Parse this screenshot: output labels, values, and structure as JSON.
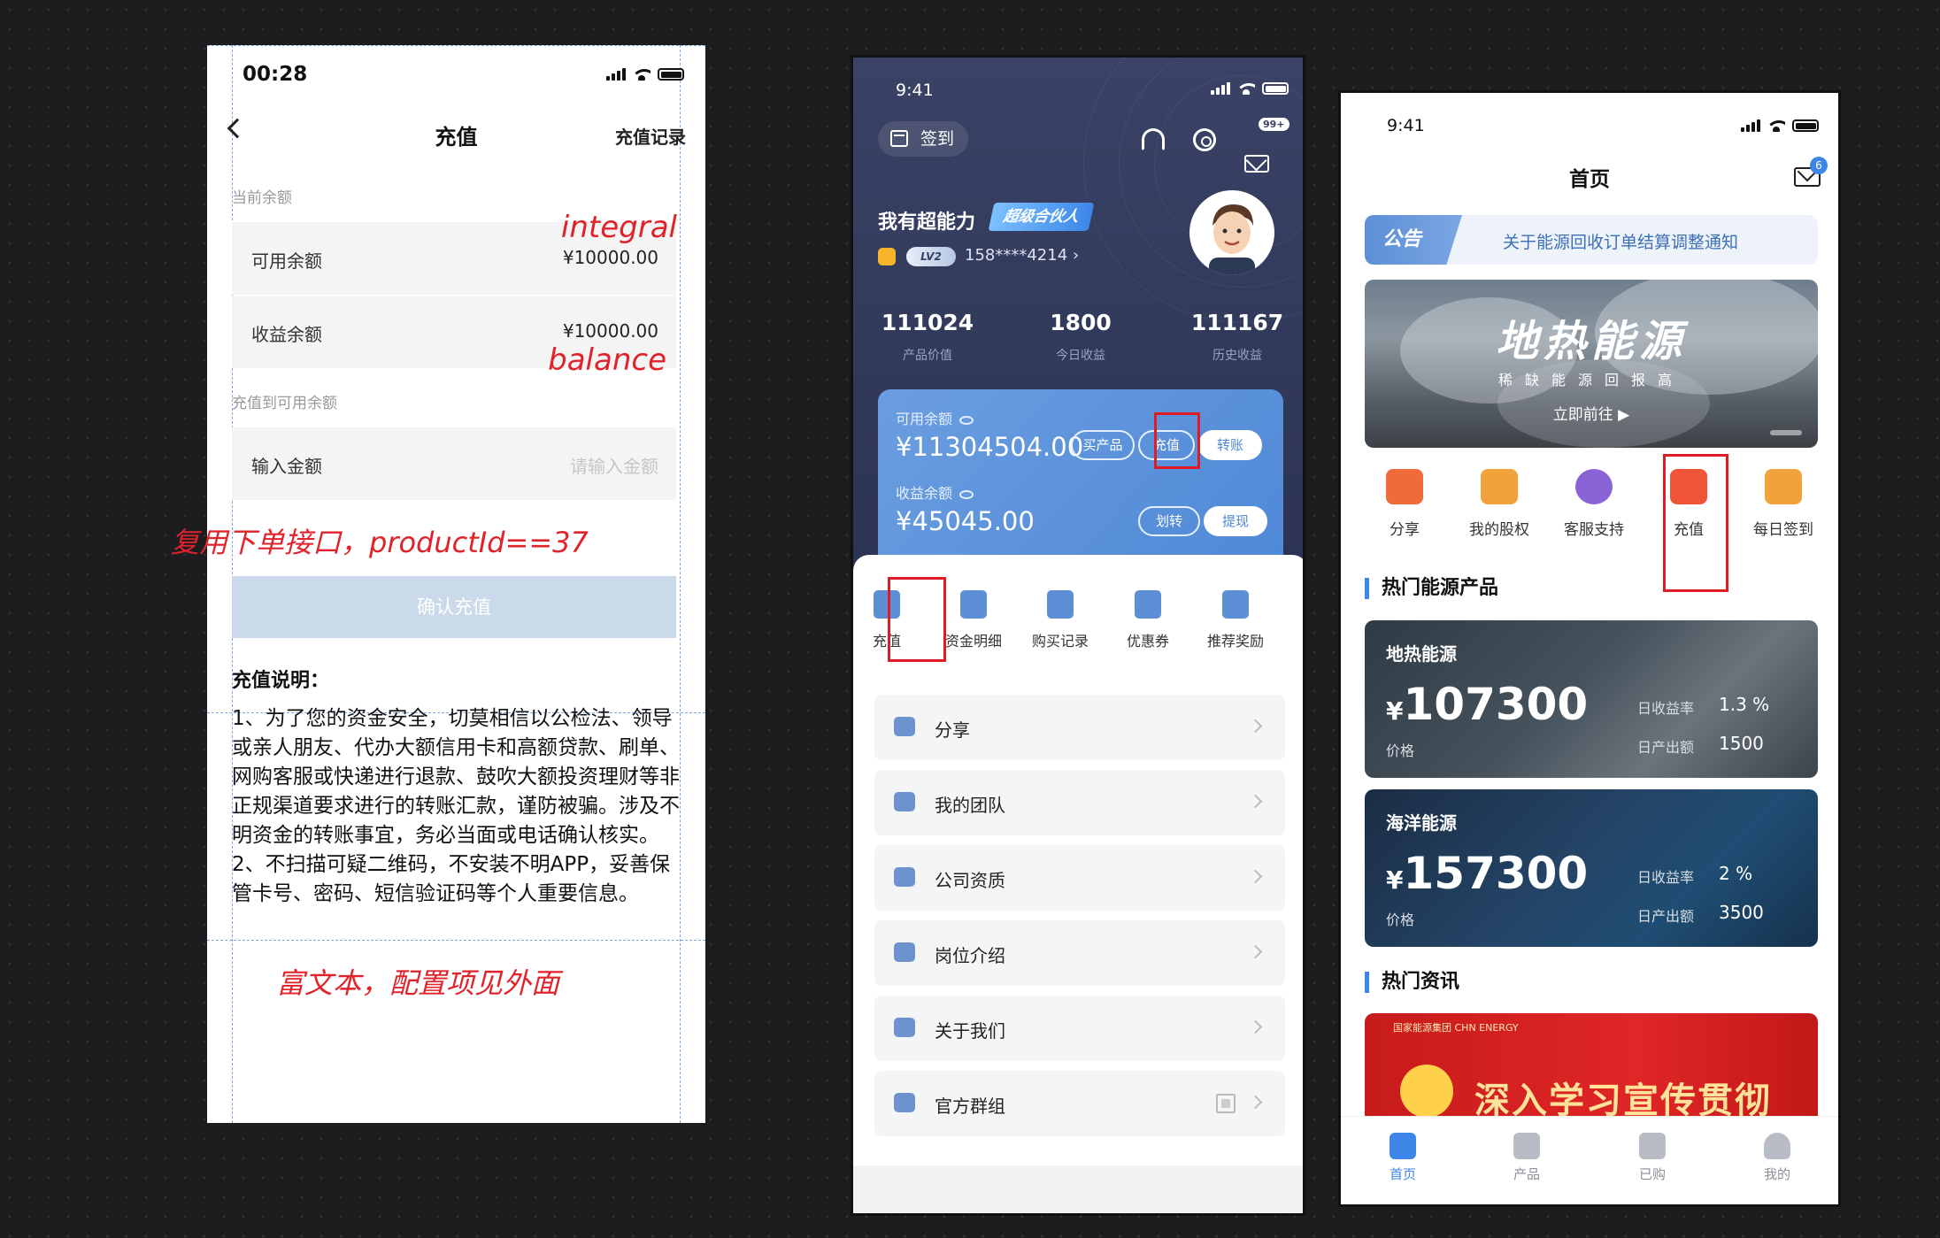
{
  "screen1": {
    "status_time": "00:28",
    "title": "充值",
    "record_link": "充值记录",
    "section_current": "当前余额",
    "available_label": "可用余额",
    "available_value": "¥10000.00",
    "earnings_label": "收益余额",
    "earnings_value": "¥10000.00",
    "section_recharge": "充值到可用余额",
    "amount_label": "输入金额",
    "amount_placeholder": "请输入金额",
    "confirm_button": "确认充值",
    "desc_title": "充值说明：",
    "desc_text": "1、为了您的资金安全，切莫相信以公检法、领导或亲人朋友、代办大额信用卡和高额贷款、刷单、网购客服或快递进行退款、鼓吹大额投资理财等非正规渠道要求进行的转账汇款，谨防被骗。涉及不明资金的转账事宜，务必当面或电话确认核实。2、不扫描可疑二维码，不安装不明APP，妥善保管卡号、密码、短信验证码等个人重要信息。",
    "annotations": {
      "integral": "integral",
      "balance": "balance",
      "reuse": "复用下单接口，productId==37",
      "rich_text": "富文本，配置项见外面"
    }
  },
  "screen2": {
    "status_time": "9:41",
    "checkin_label": "签到",
    "mail_badge": "99+",
    "user_name": "我有超能力",
    "partner_tag": "超级合伙人",
    "level_tag": "LV2",
    "phone": "158****4214 ›",
    "stats": [
      {
        "value": "111024",
        "label": "产品价值"
      },
      {
        "value": "1800",
        "label": "今日收益"
      },
      {
        "value": "111167",
        "label": "历史收益"
      }
    ],
    "available_label": "可用余额",
    "available_value": "¥11304504.00",
    "earnings_label": "收益余额",
    "earnings_value": "¥45045.00",
    "btn_buy": "买产品",
    "btn_recharge": "充值",
    "btn_transfer": "转账",
    "btn_move": "划转",
    "btn_withdraw": "提现",
    "quick_items": [
      "充值",
      "资金明细",
      "购买记录",
      "优惠券",
      "推荐奖励"
    ],
    "menu_items": [
      "分享",
      "我的团队",
      "公司资质",
      "岗位介绍",
      "关于我们",
      "官方群组"
    ]
  },
  "screen3": {
    "status_time": "9:41",
    "title": "首页",
    "mail_badge": "6",
    "notice_tag": "公告",
    "notice_text": "关于能源回收订单结算调整通知",
    "banner_title": "地热能源",
    "banner_sub": "稀缺能源回报高",
    "banner_cta": "立即前往 ▶",
    "nav_items": [
      {
        "label": "分享",
        "color": "#f06a3a"
      },
      {
        "label": "我的股权",
        "color": "#f2a23a"
      },
      {
        "label": "客服支持",
        "color": "#8a63d6"
      },
      {
        "label": "充值",
        "color": "#f0553a"
      },
      {
        "label": "每日签到",
        "color": "#f2a23a"
      }
    ],
    "hot_products_title": "热门能源产品",
    "products": [
      {
        "name": "地热能源",
        "currency": "¥",
        "price": "107300",
        "price_label": "价格",
        "rate_label": "日收益率",
        "rate": "1.3 %",
        "output_label": "日产出额",
        "output": "1500"
      },
      {
        "name": "海洋能源",
        "currency": "¥",
        "price": "157300",
        "price_label": "价格",
        "rate_label": "日收益率",
        "rate": "2 %",
        "output_label": "日产出额",
        "output": "3500"
      }
    ],
    "hot_news_title": "热门资讯",
    "news_logo": "国家能源集团 CHN ENERGY",
    "news_title": "深入学习宣传贯彻",
    "tabs": [
      "首页",
      "产品",
      "已购",
      "我的"
    ]
  }
}
